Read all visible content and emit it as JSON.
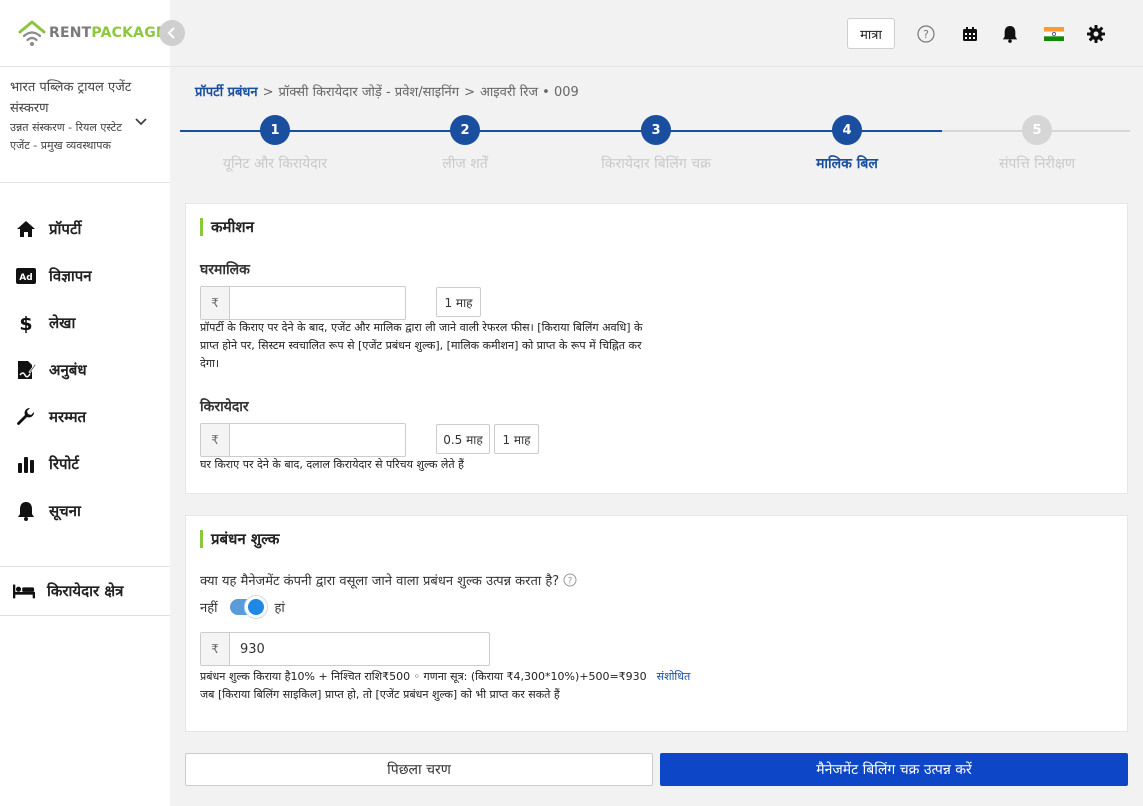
{
  "brand": {
    "rent": "RENT",
    "package": "PACKAGE"
  },
  "org": {
    "name": "भारत पब्लिक ट्रायल एजेंट संस्करण",
    "subtitle": "उन्नत संस्करण - रियल एस्टेट एजेंट - प्रमुख व्यवस्थापक"
  },
  "sidebar": {
    "items": [
      {
        "label": "प्रॉपर्टी",
        "icon": "home-icon"
      },
      {
        "label": "विज्ञापन",
        "icon": "ad-icon"
      },
      {
        "label": "लेखा",
        "icon": "dollar-icon"
      },
      {
        "label": "अनुबंध",
        "icon": "contract-icon"
      },
      {
        "label": "मरम्मत",
        "icon": "wrench-icon"
      },
      {
        "label": "रिपोर्ट",
        "icon": "bar-chart-icon"
      },
      {
        "label": "सूचना",
        "icon": "bell-icon"
      }
    ],
    "tenant_zone": {
      "label": "किरायेदार क्षेत्र",
      "icon": "bed-icon"
    }
  },
  "topbar": {
    "matra_label": "मात्रा",
    "icons": [
      "help-icon",
      "calendar-icon",
      "notification-bell-icon",
      "india-flag-icon",
      "settings-gear-icon"
    ]
  },
  "breadcrumb": {
    "root": "प्रॉपर्टी प्रबंधन",
    "step": "प्रॉक्सी किरायेदार जोड़ें - प्रवेश/साइनिंग",
    "current": "आइवरी रिज • 009",
    "separator": ">"
  },
  "stepper": {
    "active_step": 4,
    "steps": [
      {
        "num": "1",
        "label": "यूनिट और किरायेदार"
      },
      {
        "num": "2",
        "label": "लीज शर्तें"
      },
      {
        "num": "3",
        "label": "किरायेदार बिलिंग चक्र"
      },
      {
        "num": "4",
        "label": "मालिक बिल"
      },
      {
        "num": "5",
        "label": "संपत्ति निरीक्षण"
      }
    ]
  },
  "commission": {
    "title": "कमीशन",
    "landlord": {
      "label": "घरमालिक",
      "currency": "₹",
      "value": "",
      "chips": [
        "1 माह"
      ],
      "help": "प्रॉपर्टी के किराए पर देने के बाद, एजेंट और मालिक द्वारा ली जाने वाली रेफरल फीस। [किराया बिलिंग अवधि] के प्राप्त होने पर, सिस्टम स्वचालित रूप से [एजेंट प्रबंधन शुल्क], [मालिक कमीशन] को प्राप्त के रूप में चिह्नित कर देगा।"
    },
    "tenant": {
      "label": "किरायेदार",
      "currency": "₹",
      "value": "",
      "chips": [
        "0.5 माह",
        "1 माह"
      ],
      "help": "घर किराए पर देने के बाद, दलाल किरायेदार से परिचय शुल्क लेते हैं"
    }
  },
  "management_fee": {
    "title": "प्रबंधन शुल्क",
    "question": "क्या यह मैनेजमेंट कंपनी द्वारा वसूला जाने वाला प्रबंधन शुल्क उत्पन्न करता है?",
    "toggle_off_label": "नहीं",
    "toggle_on_label": "हां",
    "toggle_on": true,
    "currency": "₹",
    "value": "930",
    "formula": "प्रबंधन शुल्क किराया है10% + निश्चित राशि₹500 ◦ गणना सूत्र: (किराया ₹4,300*10%)+500=₹930",
    "edit_link": "संशोधित",
    "note": "जब [किराया बिलिंग साइकिल] प्राप्त हो, तो [एजेंट प्रबंधन शुल्क] को भी प्राप्त कर सकते हैं"
  },
  "actions": {
    "prev_label": "पिछला चरण",
    "next_label": "मैनेजमेंट बिलिंग चक्र उत्पन्न करें"
  },
  "colors": {
    "brand_green": "#8dc63f",
    "primary_blue": "#0d47c7",
    "step_active": "#1a4fa0",
    "step_inactive": "#d6d6d6"
  }
}
